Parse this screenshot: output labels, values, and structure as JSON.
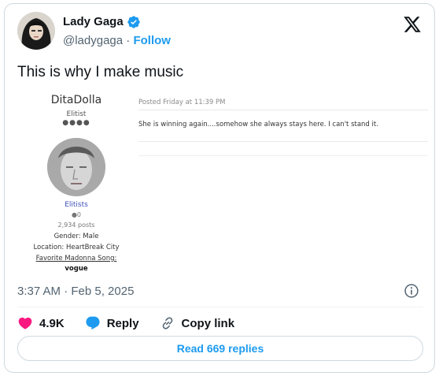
{
  "author": {
    "name": "Lady Gaga",
    "handle": "@ladygaga",
    "separator": "·",
    "follow_label": "Follow",
    "verified": true
  },
  "tweet": {
    "text": "This is why I make music",
    "timestamp": "3:37 AM · Feb 5, 2025"
  },
  "embedded_screenshot": {
    "user": {
      "name": "DitaDolla",
      "rank": "Elitist",
      "rank_dots": "●●●●",
      "group": "Elitists",
      "reputation": "●0",
      "posts": "2,934 posts",
      "gender": "Gender: Male",
      "location": "Location: HeartBreak City",
      "favorite_label": "Favorite Madonna Song:",
      "favorite_value": "vogue"
    },
    "post": {
      "meta": "Posted Friday at 11:39 PM",
      "body": "She is winning again....somehow she always stays here. I can't stand it."
    }
  },
  "actions": {
    "likes": "4.9K",
    "reply_label": "Reply",
    "copy_link_label": "Copy link"
  },
  "read_replies_label": "Read 669 replies",
  "colors": {
    "accent": "#1d9bf0",
    "like": "#f91880",
    "secondary_text": "#536471",
    "border": "#cfd9de"
  },
  "icons": {
    "verified": "verified-badge-icon",
    "x_logo": "x-logo-icon",
    "info": "info-icon",
    "like": "heart-icon",
    "reply": "speech-bubble-icon",
    "copy_link": "link-icon"
  }
}
